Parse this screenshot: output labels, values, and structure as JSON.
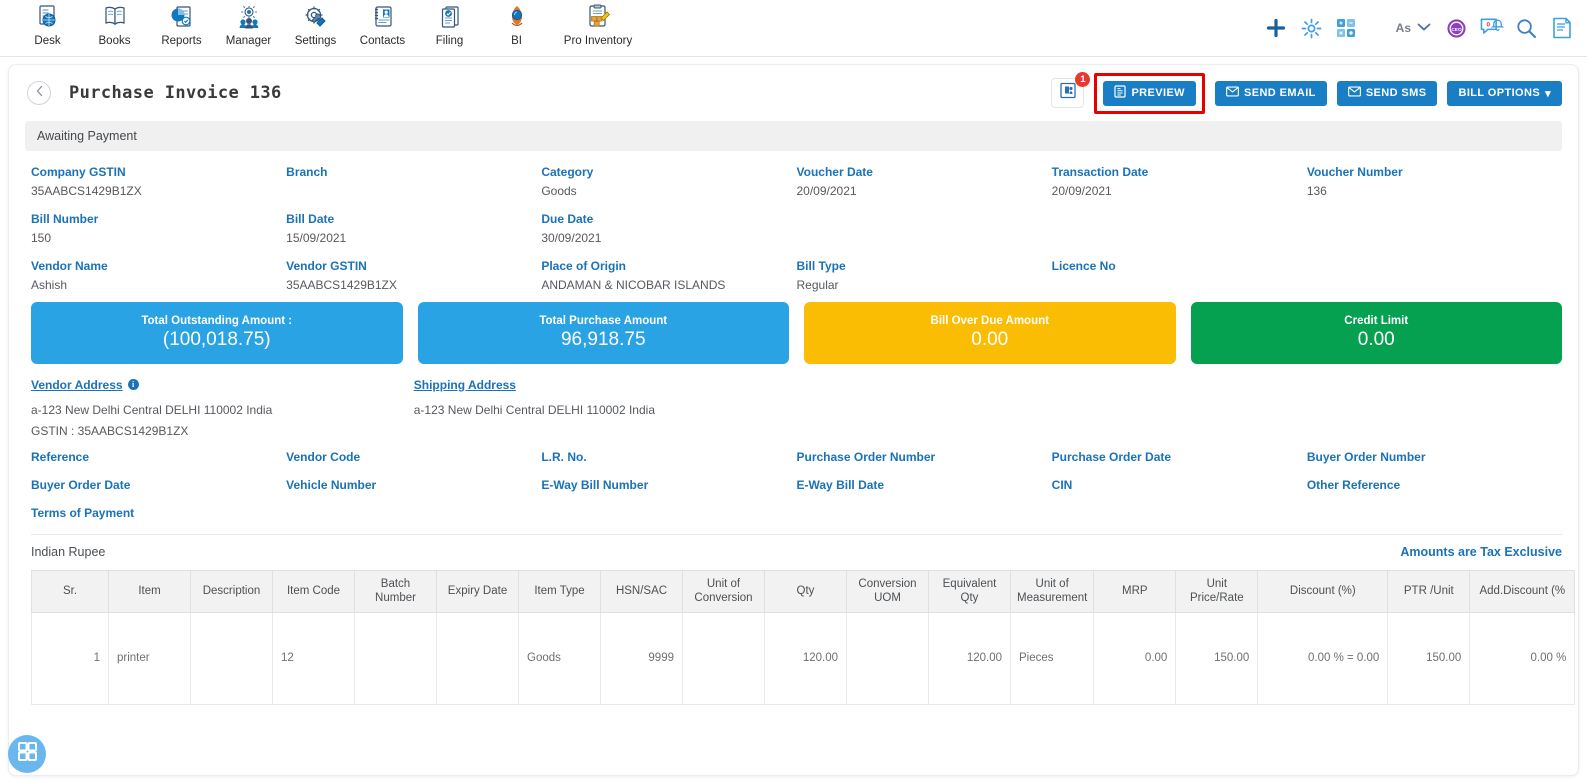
{
  "topnav": {
    "modules": [
      {
        "label": "Desk",
        "icon": "desk-globe-doc-icon"
      },
      {
        "label": "Books",
        "icon": "open-book-icon"
      },
      {
        "label": "Reports",
        "icon": "pie-chart-report-icon"
      },
      {
        "label": "Manager",
        "icon": "people-gear-icon"
      },
      {
        "label": "Settings",
        "icon": "gear-wrench-icon"
      },
      {
        "label": "Contacts",
        "icon": "contacts-card-icon"
      },
      {
        "label": "Filing",
        "icon": "filing-documents-icon"
      },
      {
        "label": "BI",
        "icon": "bi-rocket-icon"
      },
      {
        "label": "Pro Inventory",
        "icon": "inventory-clipboard-icon"
      }
    ],
    "right_icons": [
      {
        "name": "add-plus-icon"
      },
      {
        "name": "settings-gear-icon"
      },
      {
        "name": "apps-grid-icon"
      }
    ],
    "as_label": "As",
    "chevron": "chevron-down-icon",
    "avatar_icon": "user-avatar-icon",
    "notification_icon": "chat-notification-icon",
    "notification_count": "0",
    "search_icon": "search-icon",
    "notes_icon": "notes-document-icon"
  },
  "header": {
    "back_icon": "chevron-left-icon",
    "title": "Purchase Invoice 136",
    "doc_badge_count": "1",
    "doc_icon": "attachment-document-icon",
    "buttons": {
      "preview": "PREVIEW",
      "send_email": "SEND EMAIL",
      "send_sms": "SEND SMS",
      "bill_options": "BILL OPTIONS"
    },
    "highlight_color": "#e60000",
    "accent_color": "#1a7ec4"
  },
  "status": {
    "text": "Awaiting Payment"
  },
  "fields": [
    {
      "label": "Company GSTIN",
      "value": "35AABCS1429B1ZX"
    },
    {
      "label": "Branch",
      "value": ""
    },
    {
      "label": "Category",
      "value": "Goods"
    },
    {
      "label": "Voucher Date",
      "value": "20/09/2021"
    },
    {
      "label": "Transaction Date",
      "value": "20/09/2021"
    },
    {
      "label": "Voucher Number",
      "value": "136"
    },
    {
      "label": "Bill Number",
      "value": "150"
    },
    {
      "label": "Bill Date",
      "value": "15/09/2021"
    },
    {
      "label": "Due Date",
      "value": "30/09/2021"
    },
    {
      "label": "",
      "value": ""
    },
    {
      "label": "",
      "value": ""
    },
    {
      "label": "",
      "value": ""
    },
    {
      "label": "Vendor Name",
      "value": "Ashish"
    },
    {
      "label": "Vendor GSTIN",
      "value": "35AABCS1429B1ZX"
    },
    {
      "label": "Place of Origin",
      "value": "ANDAMAN & NICOBAR ISLANDS"
    },
    {
      "label": "Bill Type",
      "value": "Regular"
    },
    {
      "label": "Licence No",
      "value": ""
    },
    {
      "label": "",
      "value": ""
    }
  ],
  "summary_cards": [
    {
      "title": "Total Outstanding Amount :",
      "value": "(100,018.75)",
      "color": "#29a3e3"
    },
    {
      "title": "Total Purchase Amount",
      "value": "96,918.75",
      "color": "#29a3e3"
    },
    {
      "title": "Bill Over Due Amount",
      "value": "0.00",
      "color": "#fbbc04"
    },
    {
      "title": "Credit Limit",
      "value": "0.00",
      "color": "#05a050"
    }
  ],
  "addresses": {
    "vendor_heading": "Vendor Address",
    "vendor_info_icon": "info-icon",
    "vendor_line1": "a-123 New Delhi Central DELHI 110002 India",
    "vendor_gstin": "GSTIN :  35AABCS1429B1ZX",
    "shipping_heading": "Shipping Address",
    "shipping_line1": "a-123 New Delhi Central DELHI 110002 India"
  },
  "reference_fields": [
    "Reference",
    "Vendor Code",
    "L.R. No.",
    "Purchase Order Number",
    "Purchase Order Date",
    "Buyer Order Number",
    "Buyer Order Date",
    "Vehicle Number",
    "E-Way Bill Number",
    "E-Way Bill Date",
    "CIN",
    "Other Reference",
    "Terms of Payment",
    "",
    "",
    "",
    "",
    ""
  ],
  "currency_row": {
    "left": "Indian Rupee",
    "right": "Amounts are Tax Exclusive"
  },
  "table": {
    "columns": [
      "Sr.",
      "Item",
      "Description",
      "Item Code",
      "Batch Number",
      "Expiry Date",
      "Item Type",
      "HSN/SAC",
      "Unit of Conversion",
      "Qty",
      "Conversion UOM",
      "Equivalent Qty",
      "Unit of Measurement",
      "MRP",
      "Unit Price/Rate",
      "Discount (%)",
      "PTR /Unit",
      "Add.Discount (%"
    ],
    "rows": [
      {
        "sr": "1",
        "item": "printer",
        "description": "",
        "item_code": "12",
        "batch_number": "",
        "expiry_date": "",
        "item_type": "Goods",
        "hsn_sac": "9999",
        "unit_of_conversion": "",
        "qty": "120.00",
        "conversion_uom": "",
        "equivalent_qty": "120.00",
        "unit_of_measurement": "Pieces",
        "mrp": "0.00",
        "unit_price_rate": "150.00",
        "discount_pct": "0.00 % = 0.00",
        "ptr_unit": "150.00",
        "add_discount_pct": "0.00 %"
      }
    ]
  },
  "fab": {
    "icon": "apps-grid-icon"
  }
}
